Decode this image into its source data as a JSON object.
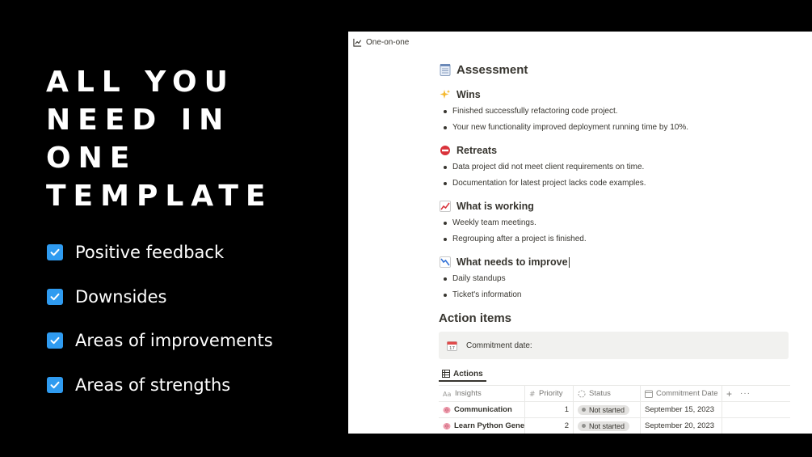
{
  "hero": {
    "lines": [
      "ALL YOU",
      "NEED IN",
      "ONE",
      "TEMPLATE"
    ]
  },
  "features": [
    {
      "label": "Positive feedback"
    },
    {
      "label": "Downsides"
    },
    {
      "label": "Areas of improvements"
    },
    {
      "label": "Areas of strengths"
    }
  ],
  "colors": {
    "accent": "#2f9bf0",
    "text": "#37352f",
    "callout_bg": "#f1f1ef"
  },
  "page": {
    "breadcrumb": "One-on-one",
    "title": "Assessment",
    "sections": [
      {
        "icon": "sparkles-icon",
        "title": "Wins",
        "items": [
          "Finished successfully refactoring code project.",
          "Your new functionality improved deployment running time by 10%."
        ]
      },
      {
        "icon": "no-entry-icon",
        "title": "Retreats",
        "items": [
          "Data project did not meet client requirements on time.",
          "Documentation for latest project lacks code examples."
        ]
      },
      {
        "icon": "chart-up-icon",
        "title": "What is working",
        "items": [
          "Weekly team meetings.",
          "Regrouping after a project is finished."
        ]
      },
      {
        "icon": "chart-down-icon",
        "title": "What needs to improve",
        "items": [
          "Daily standups",
          "Ticket's information"
        ]
      }
    ],
    "action_items": {
      "heading": "Action items",
      "callout": "Commitment date:",
      "db_tab": "Actions",
      "columns": [
        "Insights",
        "Priority",
        "Status",
        "Commitment Date"
      ],
      "rows": [
        {
          "insight": "Communication",
          "priority": "1",
          "status": "Not started",
          "date": "September 15, 2023"
        },
        {
          "insight": "Learn Python Gene",
          "priority": "2",
          "status": "Not started",
          "date": "September 20, 2023"
        }
      ]
    }
  }
}
